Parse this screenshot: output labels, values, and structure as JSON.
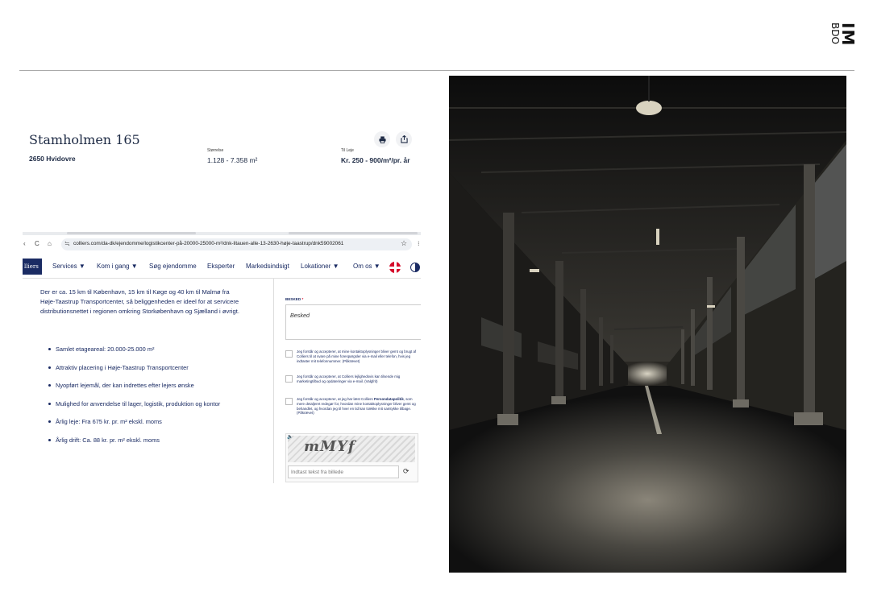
{
  "logo": {
    "big": "IM",
    "small": "BDO"
  },
  "property": {
    "title": "Stamholmen 165",
    "city": "2650 Hvidovre",
    "size_label": "Størrelse",
    "size_value": "1.128 - 7.358 m²",
    "rent_label": "Til Leje",
    "rent_value": "Kr. 250 - 900/m²/pr. år",
    "print_icon": "printer-icon",
    "share_icon": "share-icon"
  },
  "browser": {
    "url": "colliers.com/da-dk/ejendomme/logistikcenter-på-20000-25000-m²/dnk-litauen-alle-13-2630-høje-taastrup/dnk59002061",
    "back": "‹",
    "reload": "C",
    "home": "⌂",
    "site": "≒",
    "star": "☆",
    "more": "⁝"
  },
  "site_menu": {
    "brand": "lliers",
    "items": [
      "Services ▼",
      "Kom i gang ▼",
      "Søg ejendomme",
      "Eksperter",
      "Markedsindsigt",
      "Lokationer ▼",
      "Om os ▼"
    ]
  },
  "listing": {
    "description": "Der er ca. 15 km til København, 15 km til Køge og 40 km til Malmø fra Høje-Taastrup Transportcenter, så beliggenheden er ideel for at servicere distributionsnettet i regionen omkring Storkøbenhavn og Sjælland i øvrigt.",
    "bullets": [
      "Samlet etageareal: 20.000-25.000 m²",
      "Attraktiv placering i Høje-Taastrup Transportcenter",
      "Nyopført lejemål, der kan indrettes efter lejers ønske",
      "Mulighed for anvendelse til lager, logistik, produktion og kontor",
      "Årlig leje: Fra 675 kr. pr. m² ekskl. moms",
      "Årlig drift: Ca. 88 kr. pr. m² ekskl. moms"
    ]
  },
  "form": {
    "message_label": "BESKED",
    "required_mark": "*",
    "message_placeholder": "Besked",
    "consent1": "Jeg forstår og accepterer, at mine kontaktoplysninger bliver gemt og brugt af Colliers til at svare på mine forespørgsler via e-mail eller telefon, hvis jeg indtaster mit telefonnummer. (Påkrævet)",
    "consent2": "Jeg forstår og accepterer, at Colliers lejlighedsvis kan tilsende mig marketingtilbud og opdateringer via e-mail. (Valgfrit)",
    "consent3_pre": "Jeg forstår og accepterer, at jeg har læst Colliers",
    "consent3_link": "Persondatapolitik",
    "consent3_post": ", som mere detaljeret redegør for, hvordan mine kontaktoplysninger bliver gemt og behandlet, og hvordan jeg til hver en tid kan trække mit samtykke tilbage. (Påkrævet)",
    "captcha_text": "mMYf",
    "captcha_placeholder": "Indtast tekst fra billede",
    "speaker_icon": "speaker-icon",
    "refresh_icon": "refresh-icon"
  }
}
